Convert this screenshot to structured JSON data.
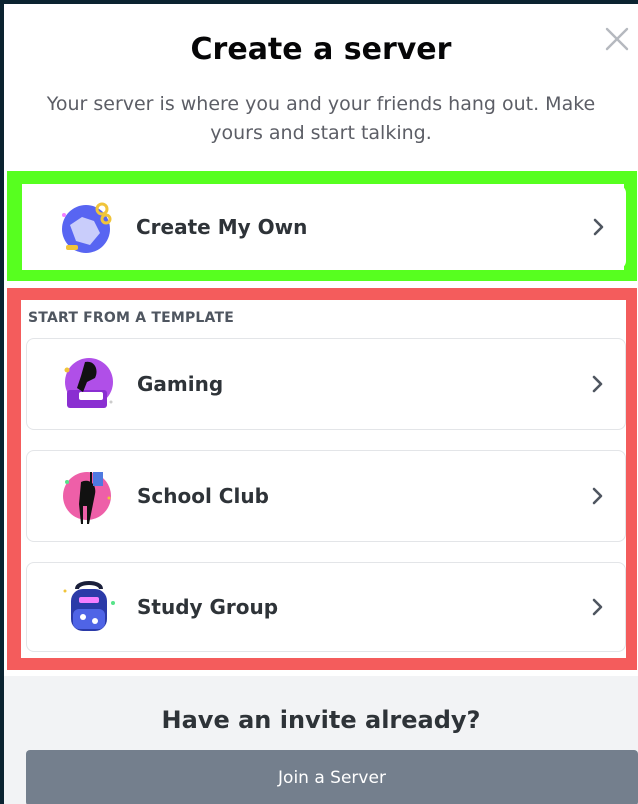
{
  "header": {
    "title": "Create a server",
    "subtitle": "Your server is where you and your friends hang out. Make yours and start talking.",
    "close_icon": "close-icon"
  },
  "primary_option": {
    "label": "Create My Own",
    "icon": "globe-icon",
    "chevron": "chevron-right-icon"
  },
  "templates": {
    "section_label": "START FROM A TEMPLATE",
    "items": [
      {
        "label": "Gaming",
        "icon": "gaming-icon"
      },
      {
        "label": "School Club",
        "icon": "school-club-icon"
      },
      {
        "label": "Study Group",
        "icon": "study-group-icon"
      }
    ]
  },
  "footer": {
    "title": "Have an invite already?",
    "join_label": "Join a Server"
  },
  "colors": {
    "highlight_green": "#57ff1f",
    "highlight_red": "#f45c5c",
    "join_button": "#747f8d"
  }
}
